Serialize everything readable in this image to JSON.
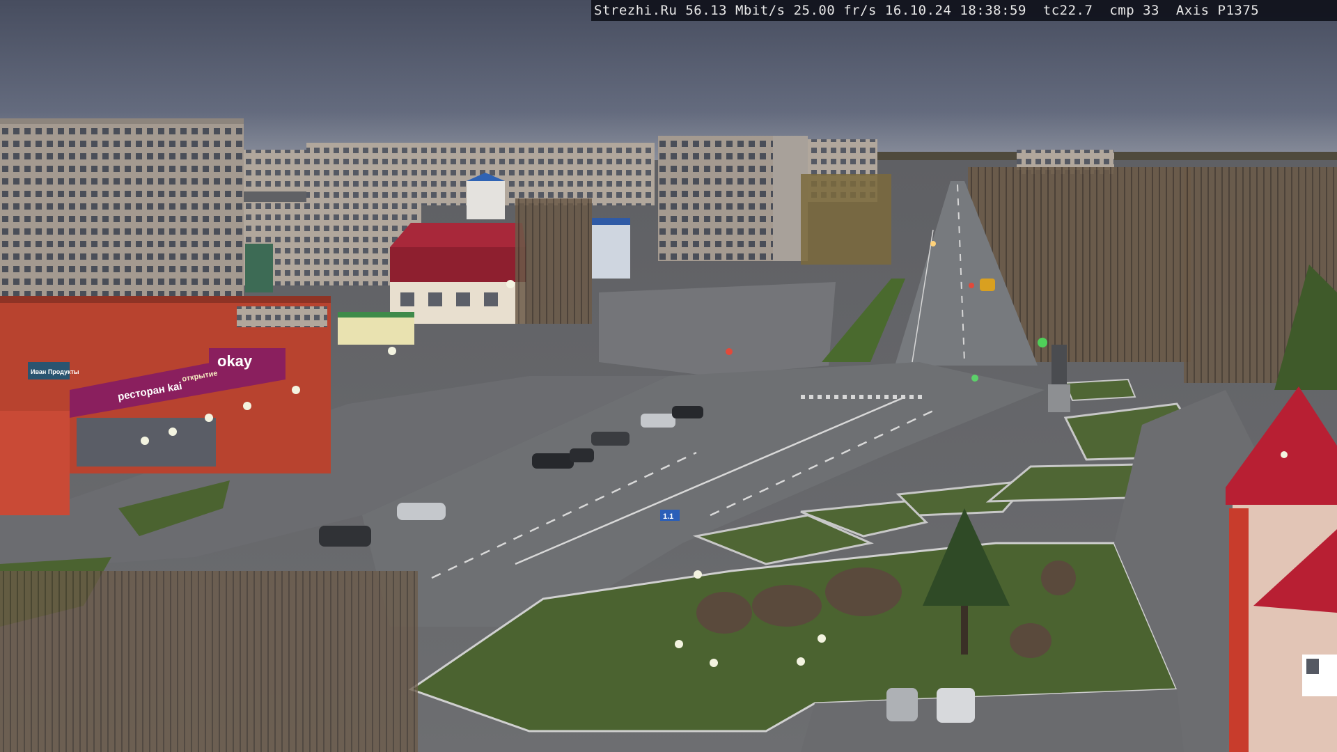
{
  "camera_overlay": {
    "site": "Strezhi.Ru",
    "bitrate": "56.13 Mbit/s",
    "framerate": "25.00 fr/s",
    "date": "16.10.24",
    "time": "18:38:59",
    "tc": "tc22.7",
    "cmp": "cmp 33",
    "model": "Axis P1375"
  },
  "signs": {
    "store_main": "okay",
    "store_facade": "ресторан kai",
    "store_banner": "открытие",
    "store_small": "Иван Продукты",
    "road_sign": "1.1"
  },
  "colors": {
    "sky_top": "#4e5466",
    "sky_horizon": "#7d8496",
    "road": "#6f7276",
    "grass": "#4b6330",
    "brick_red": "#b8432f",
    "store_magenta": "#8a1f5e",
    "roof_red": "#a8283a"
  }
}
